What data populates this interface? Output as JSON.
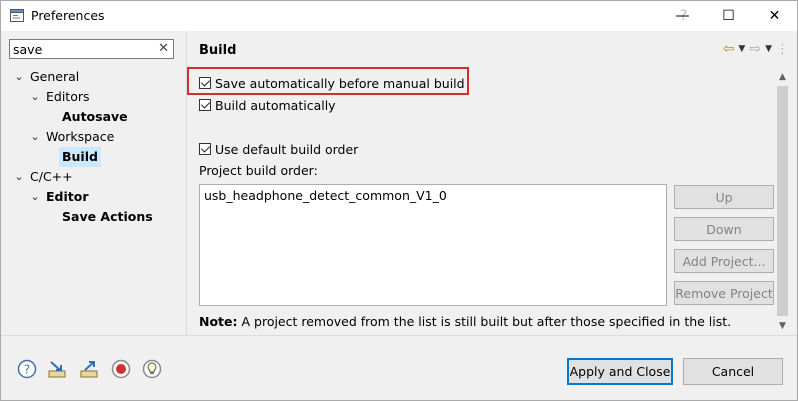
{
  "window": {
    "title": "Preferences",
    "help_glyph": "?",
    "minimize_glyph": "—",
    "maximize_glyph": "☐",
    "close_glyph": "✕"
  },
  "search": {
    "value": "save",
    "clear_glyph": "✕"
  },
  "tree": {
    "general": "General",
    "editors": "Editors",
    "autosave": "Autosave",
    "workspace": "Workspace",
    "build": "Build",
    "cpp": "C/C++",
    "editor": "Editor",
    "save_actions": "Save Actions",
    "expanded_glyph": "⌄"
  },
  "page": {
    "title": "Build",
    "save_before_build": "Save automatically before manual build",
    "build_auto": "Build automatically",
    "use_default_order": "Use default build order",
    "project_build_order_label": "Project build order:",
    "projects": [
      "usb_headphone_detect_common_V1_0"
    ],
    "buttons": {
      "up": "Up",
      "down": "Down",
      "add_project": "Add Project...",
      "remove_project": "Remove Project"
    },
    "note_bold": "Note:",
    "note_text": " A project removed from the list is still built but after those specified in the list."
  },
  "footer": {
    "apply_close": "Apply and Close",
    "cancel": "Cancel"
  },
  "colors": {
    "highlight": "#d32f2f",
    "selection": "#cce8ff",
    "nav_arrow": "#c98a18"
  }
}
